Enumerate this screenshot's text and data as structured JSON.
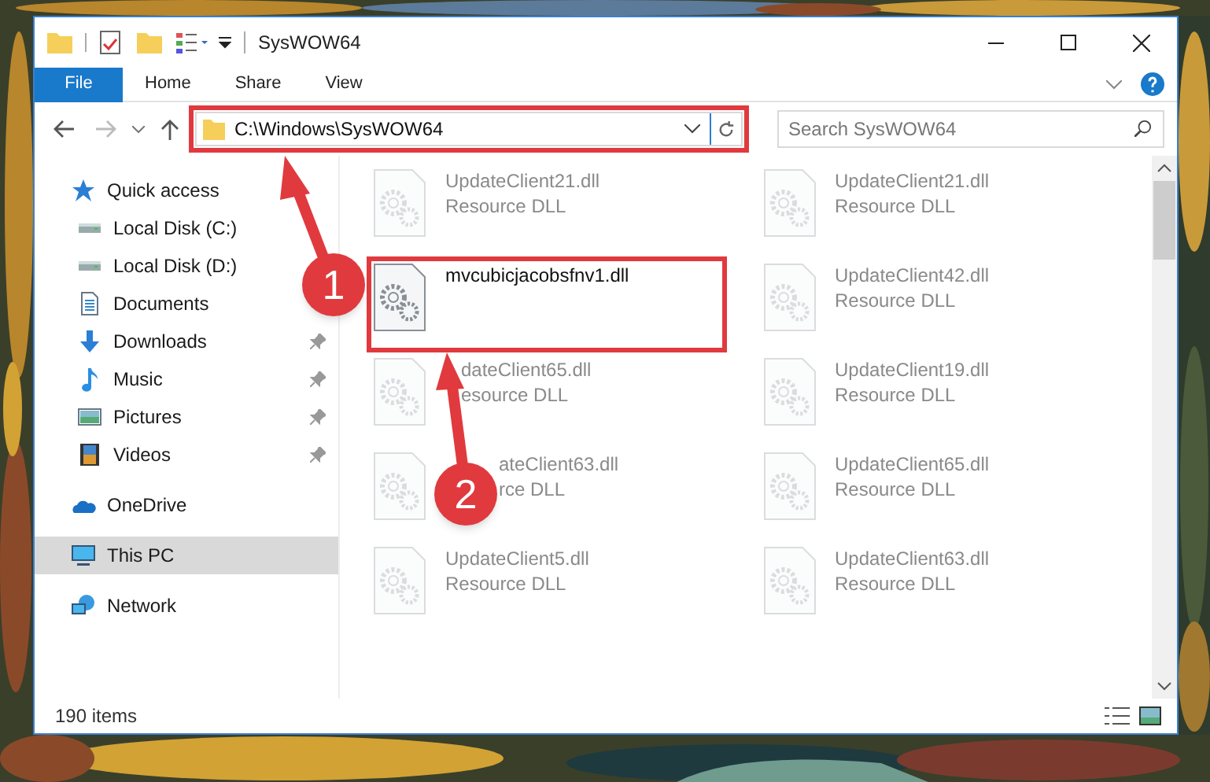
{
  "window": {
    "title": "SysWOW64"
  },
  "ribbon_tabs": [
    {
      "label": "File",
      "selected": true
    },
    {
      "label": "Home",
      "selected": false
    },
    {
      "label": "Share",
      "selected": false
    },
    {
      "label": "View",
      "selected": false
    }
  ],
  "address": {
    "path": "C:\\Windows\\SysWOW64"
  },
  "search": {
    "placeholder": "Search SysWOW64"
  },
  "nav": [
    {
      "label": "Quick access",
      "kind": "star",
      "selected": false,
      "children": [
        {
          "label": "Local Disk (C:)",
          "kind": "drive",
          "selected": false
        },
        {
          "label": "Local Disk (D:)",
          "kind": "drive",
          "selected": false
        },
        {
          "label": "Documents",
          "kind": "documents",
          "selected": false
        },
        {
          "label": "Downloads",
          "kind": "downloads",
          "pinned": true,
          "selected": false
        },
        {
          "label": "Music",
          "kind": "music",
          "pinned": true,
          "selected": false
        },
        {
          "label": "Pictures",
          "kind": "pictures",
          "pinned": true,
          "selected": false
        },
        {
          "label": "Videos",
          "kind": "videos",
          "pinned": true,
          "selected": false
        }
      ]
    },
    {
      "label": "OneDrive",
      "kind": "cloud",
      "selected": false
    },
    {
      "label": "This PC",
      "kind": "pc",
      "selected": true
    },
    {
      "label": "Network",
      "kind": "network",
      "selected": false
    }
  ],
  "files": [
    {
      "name": "UpdateClient21.dll",
      "type": "Resource DLL",
      "dimmed": true
    },
    {
      "name": "UpdateClient21.dll",
      "type": "Resource DLL",
      "dimmed": true
    },
    {
      "name": "mvcubicjacobsfnv1.dll",
      "dimmed": false
    },
    {
      "name": "UpdateClient42.dll",
      "type": "Resource DLL",
      "dimmed": true
    },
    {
      "name": "dateClient65.dll",
      "type": "esource DLL",
      "dimmed": true
    },
    {
      "name": "UpdateClient19.dll",
      "type": "Resource DLL",
      "dimmed": true
    },
    {
      "name": "ateClient63.dll",
      "type": "rce DLL",
      "dimmed": true
    },
    {
      "name": "UpdateClient65.dll",
      "type": "Resource DLL",
      "dimmed": true
    },
    {
      "name": "UpdateClient5.dll",
      "type": "Resource DLL",
      "dimmed": true
    },
    {
      "name": "UpdateClient63.dll",
      "type": "Resource DLL",
      "dimmed": true
    }
  ],
  "status_bar": {
    "count": "190 items"
  },
  "annotations": [
    {
      "label": "1"
    },
    {
      "label": "2"
    }
  ]
}
